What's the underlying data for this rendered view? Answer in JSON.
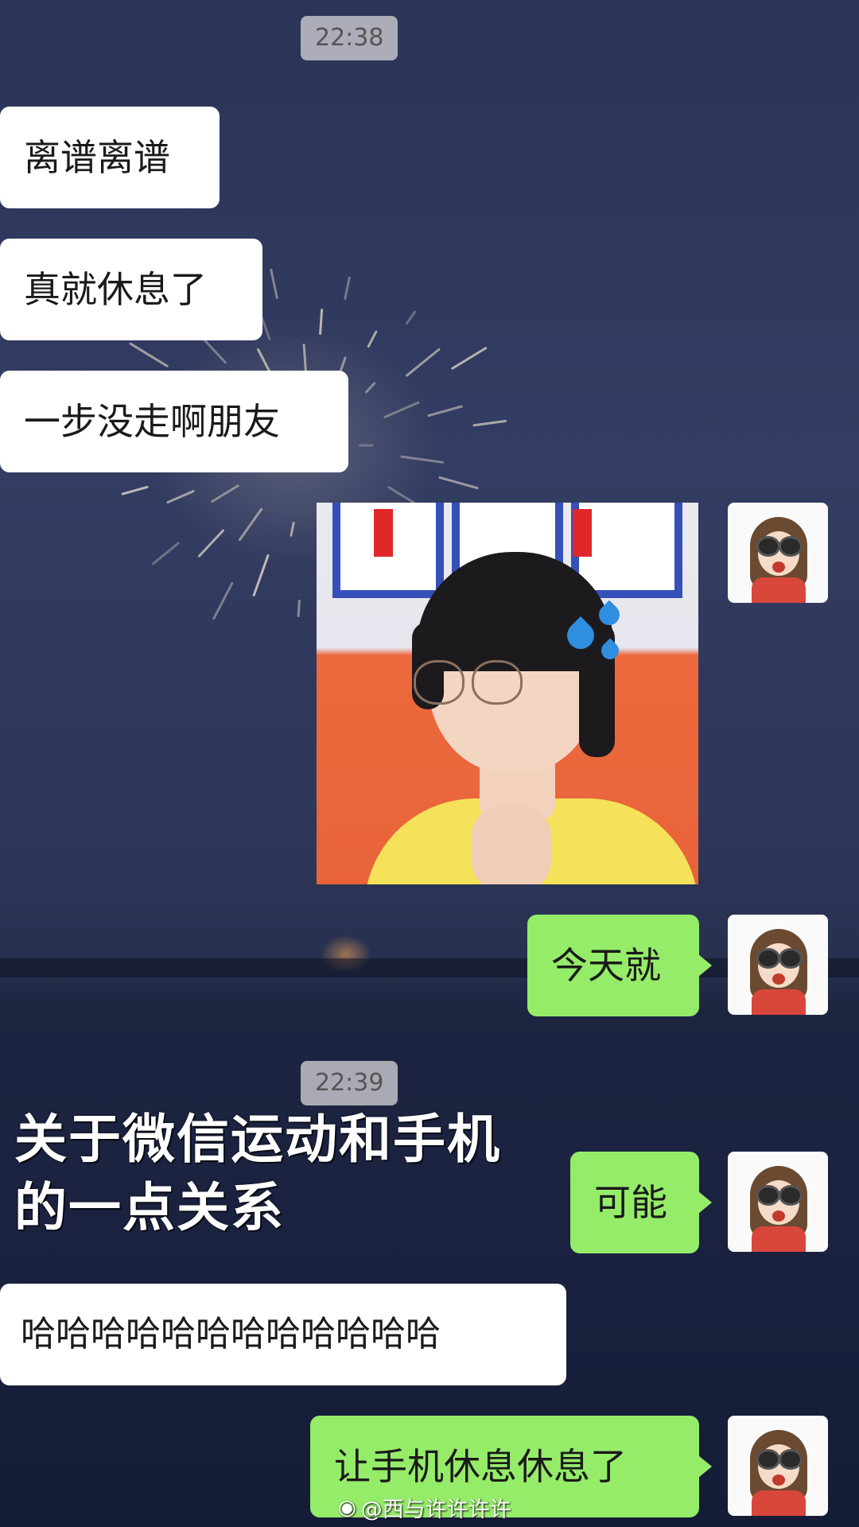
{
  "timestamps": [
    "22:38",
    "22:39"
  ],
  "messages": {
    "m1": "离谱离谱",
    "m2": "真就休息了",
    "m3": "一步没走啊朋友",
    "m4": "今天就",
    "m5": "可能",
    "m6": "哈哈哈哈哈哈哈哈哈哈哈哈",
    "m7": "让手机休息休息了"
  },
  "caption": {
    "line1": "关于微信运动和手机",
    "line2": "的一点关系"
  },
  "watermark": "@西与许许许许",
  "icons": {
    "watermark_icon": "weibo-icon",
    "avatar": "cartoon-girl-goggles-avatar",
    "emoji_overlay": "sweat-drop-icon"
  },
  "colors": {
    "incoming_bubble": "#ffffff",
    "outgoing_bubble": "#95ec69",
    "timestamp_bg": "#c8c8cd",
    "sweat_drop": "#2f8ee0"
  }
}
